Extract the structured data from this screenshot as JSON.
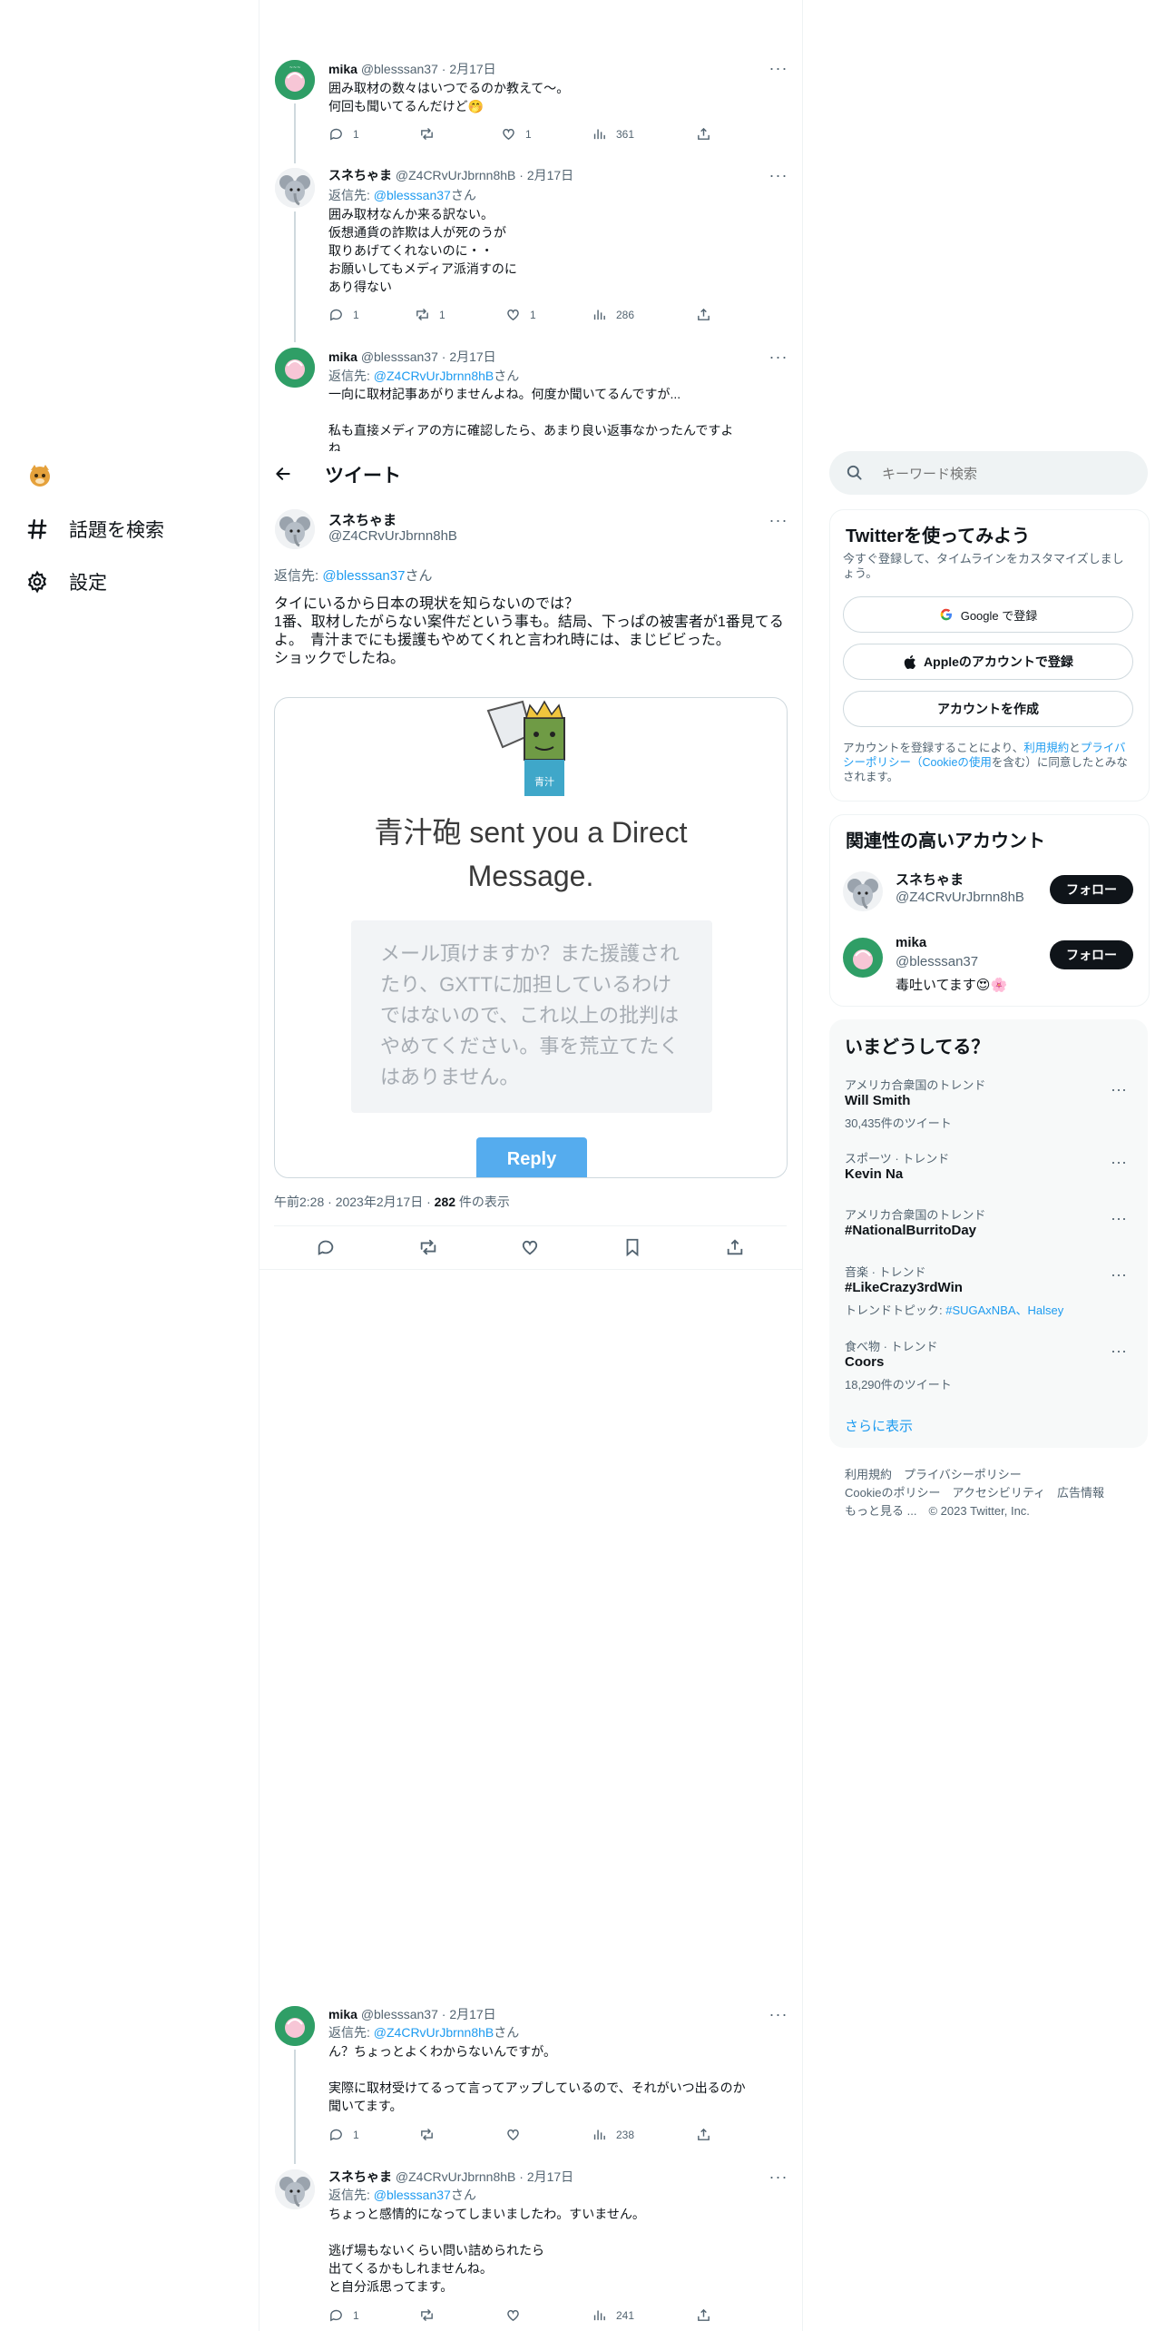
{
  "nav": {
    "explore": "話題を検索",
    "settings": "設定"
  },
  "header": {
    "title": "ツイート"
  },
  "tweets_above": [
    {
      "name": "mika",
      "handle": "@blesssan37",
      "date": "2月17日",
      "text": "囲み取材の数々はいつでるのか教えて〜。\n何回も聞いてるんだけど🤭",
      "replies": "1",
      "retweets": "",
      "likes": "1",
      "views": "361"
    },
    {
      "name": "スネちゃま",
      "handle": "@Z4CRvUrJbrnn8hB",
      "date": "2月17日",
      "reply_prefix": "返信先: ",
      "reply_to": "@blesssan37",
      "reply_suffix": "さん",
      "text": "囲み取材なんか来る訳ない。\n仮想通貨の詐欺は人が死のうが\n取りあげてくれないのに・・\nお願いしてもメディア派消すのに\nあり得ない",
      "replies": "1",
      "retweets": "1",
      "likes": "1",
      "views": "286"
    },
    {
      "name": "mika",
      "handle": "@blesssan37",
      "date": "2月17日",
      "reply_prefix": "返信先: ",
      "reply_to": "@Z4CRvUrJbrnn8hB",
      "reply_suffix": "さん",
      "text": "一向に取材記事あがりませんよね。何度か聞いてるんですが...\n\n私も直接メディアの方に確認したら、あまり良い返事なかったんですよ\nね"
    }
  ],
  "main_tweet": {
    "name": "スネちゃま",
    "handle": "@Z4CRvUrJbrnn8hB",
    "reply_prefix": "返信先: ",
    "reply_to": "@blesssan37",
    "reply_suffix": "さん",
    "text": "タイにいるから日本の現状を知らないのでは？\n1番、取材したがらない案件だという事も。結局、下っぱの被害者が1番見てるよ。　青汁までにも援護もやめてくれと言われ時には、まじビビった。\nショックでしたね。",
    "card": {
      "title": "青汁砲 sent you a Direct Message.",
      "message": "メール頂けますか？また援護されたり、GXTTに加担しているわけではないので、これ以上の批判はやめてください。事を荒立てたくはありません。",
      "reply_label": "Reply"
    },
    "time": "午前2:28",
    "date": "2023年2月17日",
    "views": "282",
    "views_suffix": "件の表示"
  },
  "tweets_below": [
    {
      "name": "mika",
      "handle": "@blesssan37",
      "date": "2月17日",
      "reply_prefix": "返信先: ",
      "reply_to": "@Z4CRvUrJbrnn8hB",
      "reply_suffix": "さん",
      "text": "ん？ちょっとよくわからないんですが。\n\n実際に取材受けてるって言ってアップしているので、それがいつ出るのか\n聞いてます。",
      "replies": "1",
      "retweets": "",
      "likes": "",
      "views": "238"
    },
    {
      "name": "スネちゃま",
      "handle": "@Z4CRvUrJbrnn8hB",
      "date": "2月17日",
      "reply_prefix": "返信先: ",
      "reply_to": "@blesssan37",
      "reply_suffix": "さん",
      "text": "ちょっと感情的になってしまいましたわ。すいません。\n\n逃げ場もないくらい問い詰められたら\n出てくるかもしれませんね。\nと自分派思ってます。",
      "replies": "1",
      "retweets": "",
      "likes": "",
      "views": "241"
    }
  ],
  "search": {
    "placeholder": "キーワード検索"
  },
  "signup": {
    "title": "Twitterを使ってみよう",
    "subtitle": "今すぐ登録して、タイムラインをカスタマイズしましょう。",
    "google": "Google で登録",
    "apple": "Appleのアカウントで登録",
    "create": "アカウントを作成",
    "legal_1": "アカウントを登録することにより、",
    "legal_terms": "利用規約",
    "legal_2": "と",
    "legal_privacy": "プライバシーポリシー（Cookieの使用",
    "legal_3": "を含む）に同意したとみなされます。"
  },
  "relevant": {
    "title": "関連性の高いアカウント",
    "accounts": [
      {
        "name": "スネちゃま",
        "handle": "@Z4CRvUrJbrnn8hB",
        "bio": "",
        "follow": "フォロー"
      },
      {
        "name": "mika",
        "handle": "@blesssan37",
        "bio": "毒吐いてます😍🌸",
        "follow": "フォロー"
      }
    ]
  },
  "trends": {
    "title": "いまどうしてる？",
    "items": [
      {
        "category": "アメリカ合衆国のトレンド",
        "name": "Will Smith",
        "count": "30,435件のツイート"
      },
      {
        "category": "スポーツ · トレンド",
        "name": "Kevin Na",
        "count": ""
      },
      {
        "category": "アメリカ合衆国のトレンド",
        "name": "#NationalBurritoDay",
        "count": ""
      },
      {
        "category": "音楽 · トレンド",
        "name": "#LikeCrazy3rdWin",
        "count": "トレンドトピック: ",
        "topics": "#SUGAxNBA、Halsey"
      },
      {
        "category": "食べ物 · トレンド",
        "name": "Coors",
        "count": "18,290件のツイート"
      }
    ],
    "show_more": "さらに表示"
  },
  "footer": {
    "line1": "利用規約　プライバシーポリシー",
    "line2": "Cookieのポリシー　アクセシビリティ　広告情報",
    "line3": "もっと見る ...　© 2023 Twitter, Inc."
  },
  "colors": {
    "accent": "#1d9bf0",
    "text": "#0f1419",
    "secondary": "#536471",
    "reply_button": "#55acee"
  }
}
